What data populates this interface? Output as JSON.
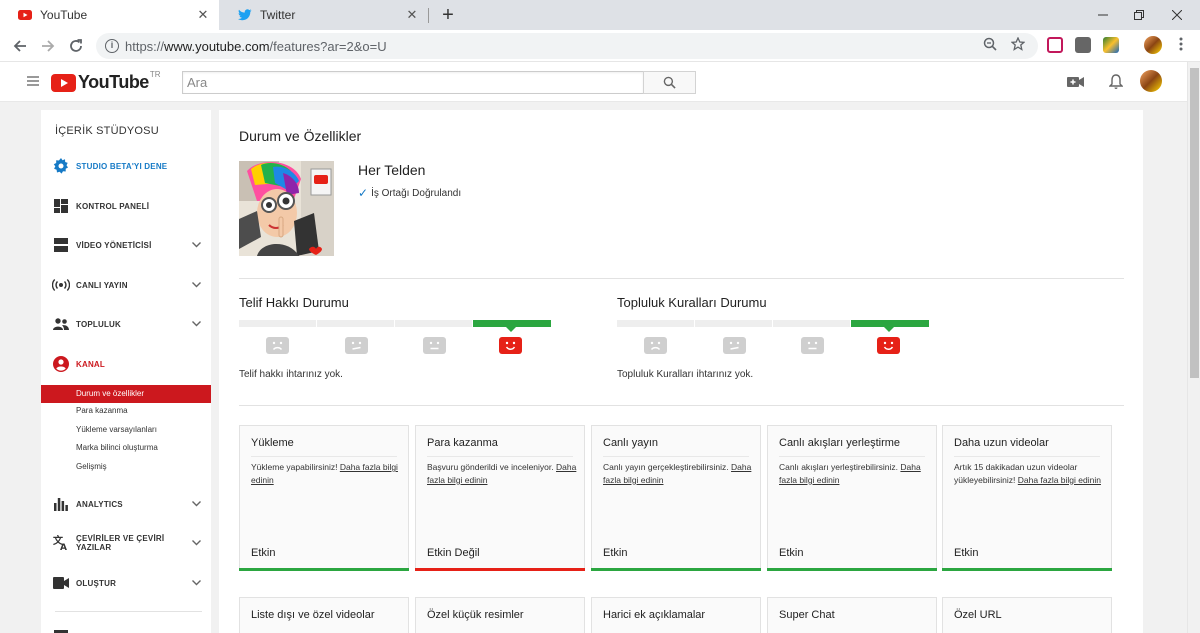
{
  "browser": {
    "tabs": [
      {
        "title": "YouTube",
        "active": true,
        "favicon": "youtube-icon"
      },
      {
        "title": "Twitter",
        "active": false,
        "favicon": "twitter-icon"
      }
    ],
    "url": {
      "scheme": "https://",
      "host": "www.youtube.com",
      "path": "/features?ar=2&o=U"
    }
  },
  "masthead": {
    "logo_text": "YouTube",
    "country_code": "TR",
    "search_placeholder": "Ara"
  },
  "sidebar": {
    "title": "İÇERİK STÜDYOSU",
    "items": [
      {
        "label": "STUDIO BETA'YI DENE",
        "icon": "gear-icon",
        "color": "#167ac6",
        "expandable": false
      },
      {
        "label": "KONTROL PANELİ",
        "icon": "dashboard-icon",
        "expandable": false
      },
      {
        "label": "VİDEO YÖNETİCİSİ",
        "icon": "video-manager-icon",
        "expandable": true
      },
      {
        "label": "CANLI YAYIN",
        "icon": "live-icon",
        "expandable": true
      },
      {
        "label": "TOPLULUK",
        "icon": "community-icon",
        "expandable": true
      },
      {
        "label": "KANAL",
        "icon": "channel-icon",
        "color": "#cc181e",
        "expandable": false
      }
    ],
    "channel_subitems": [
      {
        "label": "Durum ve özellikler",
        "active": true
      },
      {
        "label": "Para kazanma",
        "active": false
      },
      {
        "label": "Yükleme varsayılanları",
        "active": false
      },
      {
        "label": "Marka bilinci oluşturma",
        "active": false
      },
      {
        "label": "Gelişmiş",
        "active": false
      }
    ],
    "items_after": [
      {
        "label": "ANALYTICS",
        "icon": "analytics-icon",
        "expandable": true
      },
      {
        "label": "ÇEVİRİLER VE ÇEVİRİ YAZILAR",
        "icon": "translate-icon",
        "expandable": true
      },
      {
        "label": "OLUŞTUR",
        "icon": "create-icon",
        "expandable": true
      }
    ]
  },
  "main": {
    "title": "Durum ve Özellikler",
    "channel_name": "Her Telden",
    "verified_text": "İş Ortağı Doğrulandı",
    "copyright": {
      "title": "Telif Hakkı Durumu",
      "message": "Telif hakkı ihtarınız yok."
    },
    "community": {
      "title": "Topluluk Kuralları Durumu",
      "message": "Topluluk Kuralları ihtarınız yok."
    },
    "features": [
      {
        "title": "Yükleme",
        "desc": "Yükleme yapabilirsiniz!",
        "link": "Daha fazla bilgi edinin",
        "status": "Etkin",
        "enabled": true
      },
      {
        "title": "Para kazanma",
        "desc": "Başvuru gönderildi ve inceleniyor.",
        "link": "Daha fazla bilgi edinin",
        "status": "Etkin Değil",
        "enabled": false
      },
      {
        "title": "Canlı yayın",
        "desc": "Canlı yayın gerçekleştirebilirsiniz.",
        "link": "Daha fazla bilgi edinin",
        "status": "Etkin",
        "enabled": true
      },
      {
        "title": "Canlı akışları yerleştirme",
        "desc": "Canlı akışları yerleştirebilirsiniz.",
        "link": "Daha fazla bilgi edinin",
        "status": "Etkin",
        "enabled": true
      },
      {
        "title": "Daha uzun videolar",
        "desc": "Artık 15 dakikadan uzun videolar yükleyebilirsiniz!",
        "link": "Daha fazla bilgi edinin",
        "status": "Etkin",
        "enabled": true
      }
    ],
    "features_row2": [
      {
        "title": "Liste dışı ve özel videolar"
      },
      {
        "title": "Özel küçük resimler"
      },
      {
        "title": "Harici ek açıklamalar"
      },
      {
        "title": "Super Chat"
      },
      {
        "title": "Özel URL"
      }
    ]
  },
  "colors": {
    "brand_red": "#e62117",
    "status_green": "#2ba640",
    "accent_blue": "#167ac6"
  }
}
